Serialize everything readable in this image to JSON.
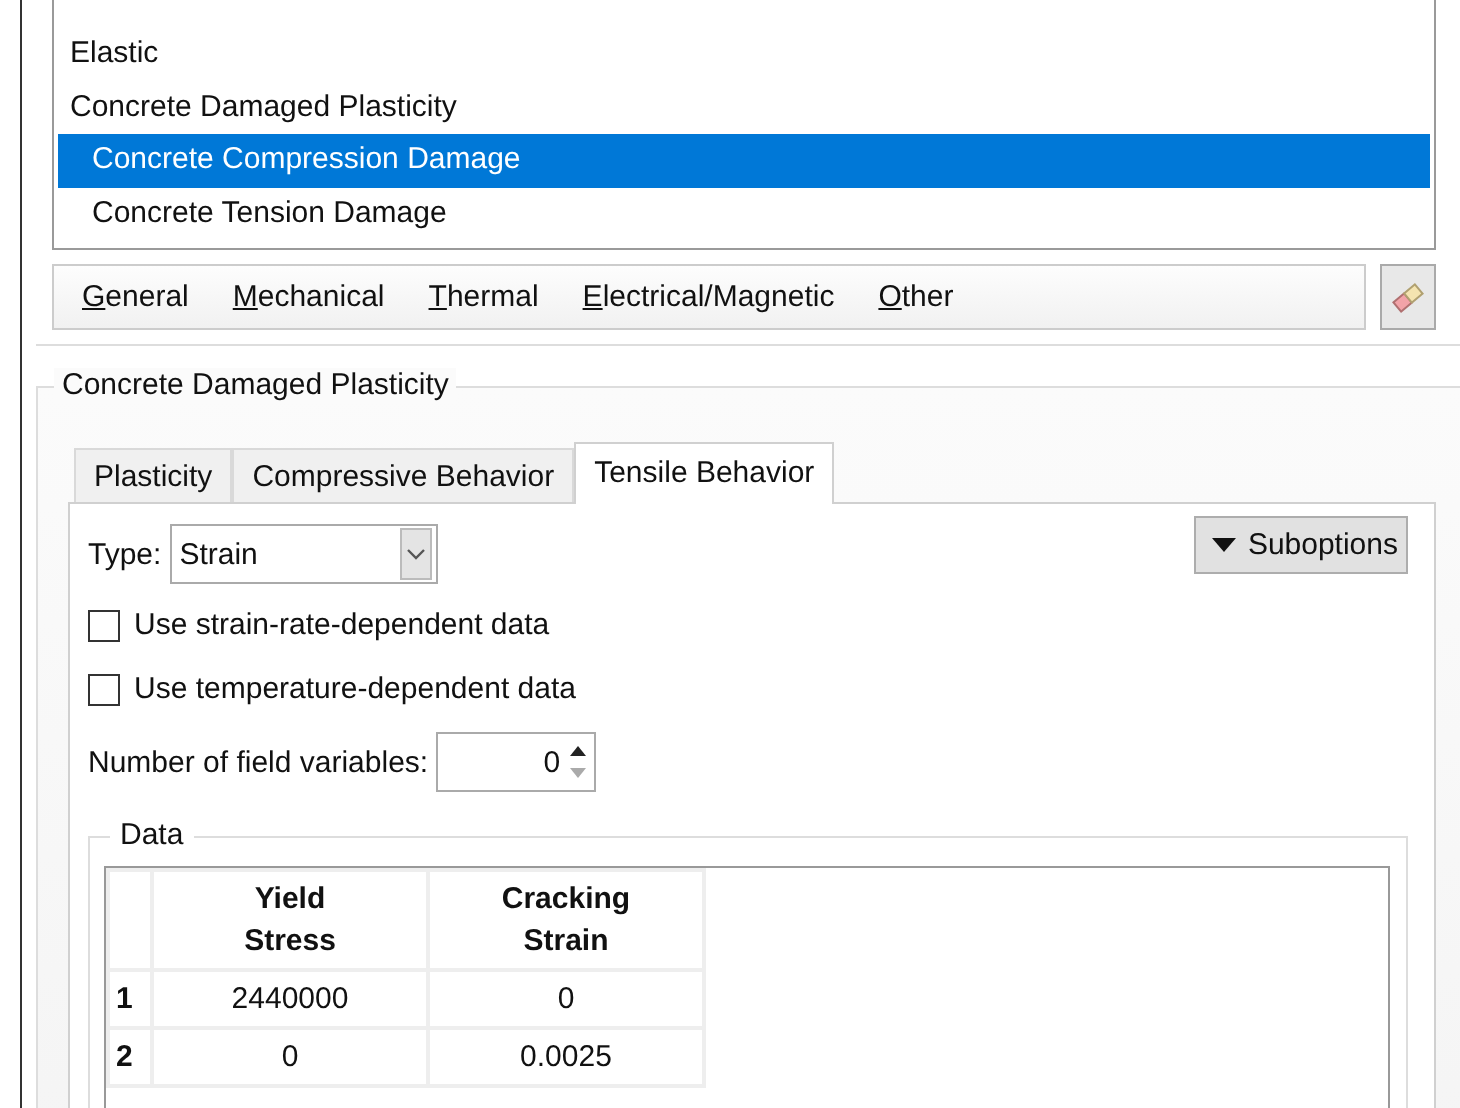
{
  "material_behaviors": {
    "items": [
      {
        "label": "Elastic",
        "selected": false
      },
      {
        "label": "Concrete Damaged Plasticity",
        "selected": false,
        "children": [
          {
            "label": "Concrete Compression Damage",
            "selected": true
          },
          {
            "label": "Concrete Tension Damage",
            "selected": false
          }
        ]
      }
    ]
  },
  "menu": [
    "General",
    "Mechanical",
    "Thermal",
    "Electrical/Magnetic",
    "Other"
  ],
  "behavior_group": {
    "title": "Concrete Damaged Plasticity",
    "tabs": [
      {
        "label": "Plasticity",
        "selected": false
      },
      {
        "label": "Compressive Behavior",
        "selected": false
      },
      {
        "label": "Tensile Behavior",
        "selected": true
      }
    ],
    "type": {
      "label": "Type:",
      "value": "Strain"
    },
    "suboptions": "Suboptions",
    "checkboxes": [
      {
        "label": "Use strain-rate-dependent data",
        "checked": false
      },
      {
        "label": "Use temperature-dependent data",
        "checked": false
      }
    ],
    "field_variables": {
      "label": "Number of field variables:",
      "value": "0"
    },
    "data": {
      "title": "Data",
      "columns": [
        "Yield Stress",
        "Cracking Strain"
      ],
      "rows": [
        {
          "index": "1",
          "cells": [
            "2440000",
            "0"
          ]
        },
        {
          "index": "2",
          "cells": [
            "0",
            "0.0025"
          ]
        }
      ]
    }
  }
}
